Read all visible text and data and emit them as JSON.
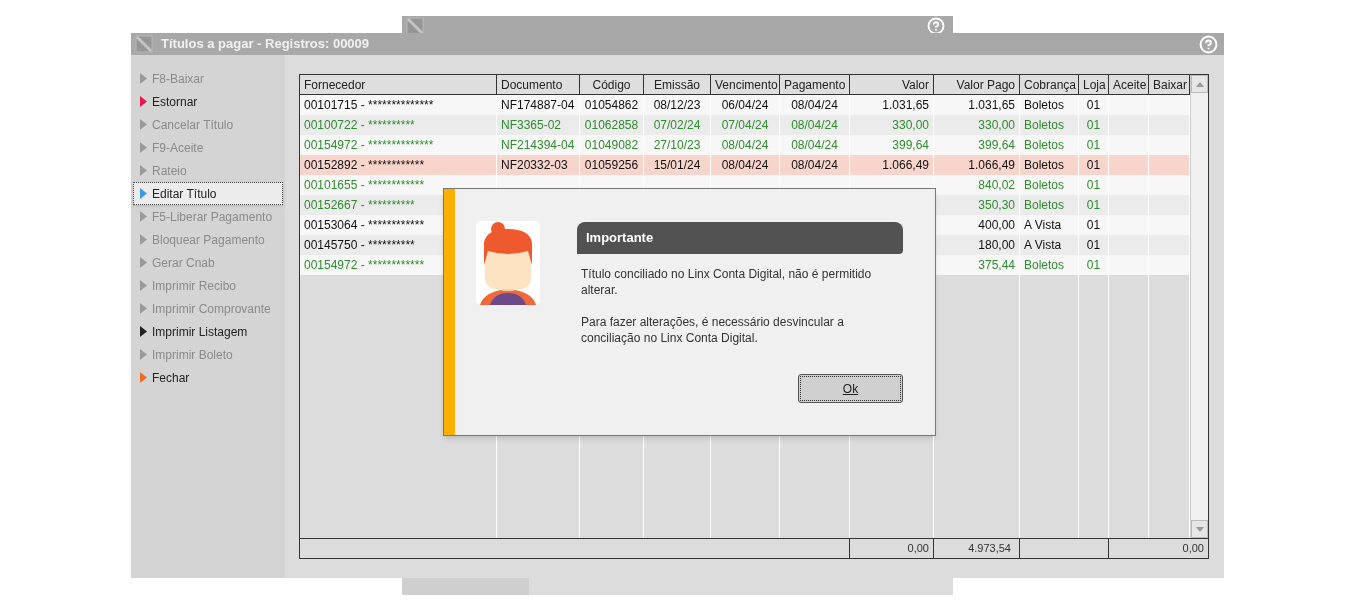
{
  "window": {
    "title": "Títulos a pagar - Registros: 00009"
  },
  "sidebar": {
    "items": [
      {
        "label": "F8-Baixar",
        "disabled": true,
        "selected": false,
        "color": "#9a9a9a"
      },
      {
        "label": "Estornar",
        "disabled": false,
        "selected": false,
        "color": "#e8174b"
      },
      {
        "label": "Cancelar Título",
        "disabled": true,
        "selected": false,
        "color": "#9a9a9a"
      },
      {
        "label": "F9-Aceite",
        "disabled": true,
        "selected": false,
        "color": "#9a9a9a"
      },
      {
        "label": "Rateio",
        "disabled": true,
        "selected": false,
        "color": "#9a9a9a"
      },
      {
        "label": "Editar Título",
        "disabled": false,
        "selected": true,
        "color": "#3b9be0"
      },
      {
        "label": "F5-Liberar Pagamento",
        "disabled": true,
        "selected": false,
        "color": "#9a9a9a"
      },
      {
        "label": "Bloquear Pagamento",
        "disabled": true,
        "selected": false,
        "color": "#9a9a9a"
      },
      {
        "label": "Gerar Cnab",
        "disabled": true,
        "selected": false,
        "color": "#9a9a9a"
      },
      {
        "label": "Imprimir Recibo",
        "disabled": true,
        "selected": false,
        "color": "#9a9a9a"
      },
      {
        "label": "Imprimir Comprovante",
        "disabled": true,
        "selected": false,
        "color": "#9a9a9a"
      },
      {
        "label": "Imprimir Listagem",
        "disabled": false,
        "selected": false,
        "color": "#222222"
      },
      {
        "label": "Imprimir Boleto",
        "disabled": true,
        "selected": false,
        "color": "#9a9a9a"
      },
      {
        "label": "Fechar",
        "disabled": false,
        "selected": false,
        "color": "#f06a25"
      }
    ]
  },
  "table": {
    "columns": [
      "Fornecedor",
      "Documento",
      "Código",
      "Emissão",
      "Vencimento",
      "Pagamento",
      "Valor",
      "Valor Pago",
      "Cobrança",
      "Loja",
      "Aceite",
      "Baixar"
    ],
    "rows": [
      {
        "color": "#111111",
        "selected": false,
        "fornecedor": "00101715 - **************",
        "documento": "NF174887-04",
        "codigo": "01054862",
        "emissao": "08/12/23",
        "vencimento": "06/04/24",
        "pagamento": "08/04/24",
        "valor": "1.031,65",
        "valor_pago": "1.031,65",
        "cobranca": "Boletos",
        "loja": "01"
      },
      {
        "color": "#2e8b2e",
        "selected": false,
        "fornecedor": "00100722 -  **********",
        "documento": "NF3365-02",
        "codigo": "01062858",
        "emissao": "07/02/24",
        "vencimento": "07/04/24",
        "pagamento": "08/04/24",
        "valor": "330,00",
        "valor_pago": "330,00",
        "cobranca": "Boletos",
        "loja": "01"
      },
      {
        "color": "#2e8b2e",
        "selected": false,
        "fornecedor": "00154972 - **************",
        "documento": "NF214394-04",
        "codigo": "01049082",
        "emissao": "27/10/23",
        "vencimento": "08/04/24",
        "pagamento": "08/04/24",
        "valor": "399,64",
        "valor_pago": "399,64",
        "cobranca": "Boletos",
        "loja": "01"
      },
      {
        "color": "#111111",
        "selected": true,
        "fornecedor": "00152892 - ************",
        "documento": "NF20332-03",
        "codigo": "01059256",
        "emissao": "15/01/24",
        "vencimento": "08/04/24",
        "pagamento": "08/04/24",
        "valor": "1.066,49",
        "valor_pago": "1.066,49",
        "cobranca": "Boletos",
        "loja": "01"
      },
      {
        "color": "#2e8b2e",
        "selected": false,
        "fornecedor": "00101655 - ************",
        "valor_pago": "840,02",
        "cobranca": "Boletos",
        "loja": "01"
      },
      {
        "color": "#2e8b2e",
        "selected": false,
        "fornecedor": "00152667 - **********",
        "valor_pago": "350,30",
        "cobranca": "Boletos",
        "loja": "01"
      },
      {
        "color": "#111111",
        "selected": false,
        "fornecedor": "00153064 - ************",
        "valor_pago": "400,00",
        "cobranca": "A Vista",
        "loja": "01"
      },
      {
        "color": "#111111",
        "selected": false,
        "fornecedor": "00145750 - **********",
        "valor_pago": "180,00",
        "cobranca": "A Vista",
        "loja": "01"
      },
      {
        "color": "#2e8b2e",
        "selected": false,
        "fornecedor": "00154972 - ************",
        "valor_pago": "375,44",
        "cobranca": "Boletos",
        "loja": "01"
      }
    ],
    "totals": {
      "valor": "0,00",
      "valor_pago": "4.973,54",
      "baixar": "0,00"
    }
  },
  "dialog": {
    "title": "Importante",
    "paragraphs": [
      "Título conciliado no Linx Conta Digital, não é permitido alterar.",
      "Para fazer alterações, é necessário desvincular a conciliação no Linx Conta Digital."
    ],
    "button": "Ok"
  }
}
